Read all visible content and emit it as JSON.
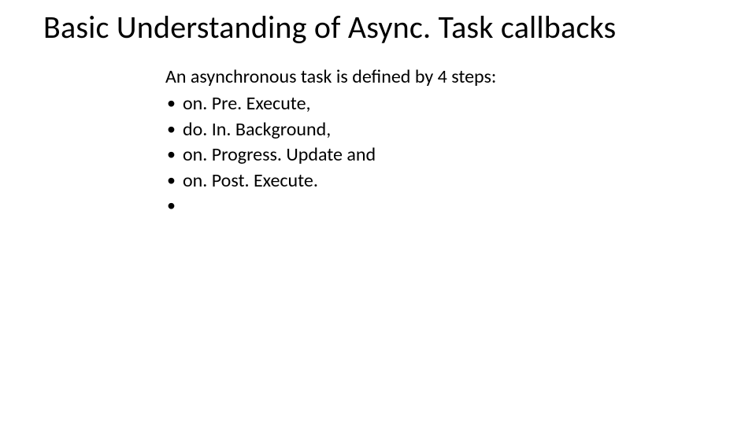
{
  "title": "Basic Understanding of Async. Task callbacks",
  "intro": "An asynchronous task is defined by 4 steps:",
  "bullets": [
    " on. Pre. Execute,",
    "do. In. Background,",
    "on. Progress. Update and",
    "on. Post. Execute.",
    ""
  ]
}
